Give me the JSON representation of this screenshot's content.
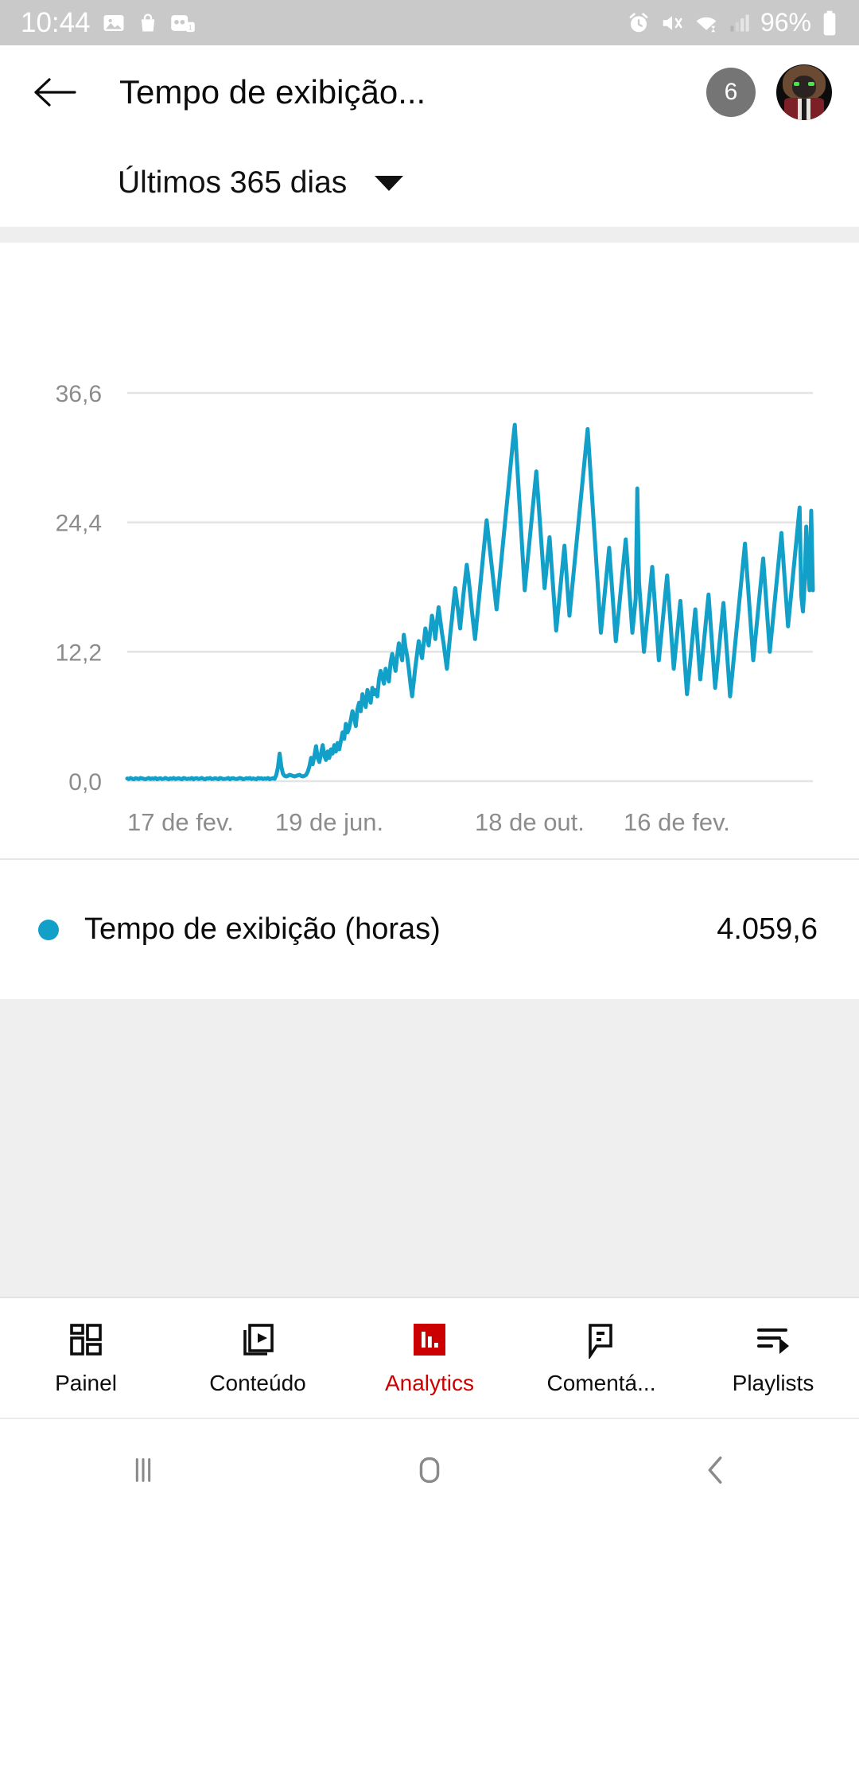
{
  "status_bar": {
    "time": "10:44",
    "battery_percent": "96%",
    "left_icons": [
      "gallery-icon",
      "shopping-bag-icon",
      "voicemail-icon"
    ],
    "right_icons": [
      "alarm-icon",
      "mute-vibrate-icon",
      "wifi-icon",
      "cellular-signal-icon"
    ]
  },
  "app_bar": {
    "back_icon": "back-arrow-icon",
    "title": "Tempo de exibição...",
    "badge_count": "6",
    "avatar_icon": "account-avatar"
  },
  "range_selector": {
    "label": "Últimos 365 dias",
    "caret_icon": "chevron-down-icon"
  },
  "legend": {
    "series_label": "Tempo de exibição (horas)",
    "total_value": "4.059,6",
    "dot_color": "#12a0c8"
  },
  "tab_bar": {
    "active_color": "#cc0000",
    "items": [
      {
        "label": "Painel",
        "icon": "dashboard-grid-icon",
        "active": false
      },
      {
        "label": "Conteúdo",
        "icon": "video-content-icon",
        "active": false
      },
      {
        "label": "Analytics",
        "icon": "bar-chart-icon",
        "active": true
      },
      {
        "label": "Comentá...",
        "icon": "comment-bubble-icon",
        "active": false
      },
      {
        "label": "Playlists",
        "icon": "playlist-icon",
        "active": false
      }
    ]
  },
  "nav_bar": {
    "items": [
      {
        "icon": "recents-icon"
      },
      {
        "icon": "home-icon"
      },
      {
        "icon": "back-icon"
      }
    ]
  },
  "chart_data": {
    "type": "line",
    "title": "Tempo de exibição (horas)",
    "xlabel": "",
    "ylabel": "",
    "grid": true,
    "legend_position": "below-chart",
    "line_color": "#12a0c8",
    "ylim": [
      0,
      36.6
    ],
    "ytick_labels": [
      "0,0",
      "12,2",
      "24,4",
      "36,6"
    ],
    "ytick_values": [
      0,
      12.2,
      24.4,
      36.6
    ],
    "xtick_labels": [
      "17 de fev.",
      "19 de jun.",
      "18 de out.",
      "16 de fev."
    ],
    "xtick_indices": [
      0,
      122,
      243,
      364
    ],
    "series": [
      {
        "name": "Tempo de exibição (horas)",
        "total": 4059.6,
        "values": [
          0.25,
          0.2,
          0.3,
          0.22,
          0.18,
          0.28,
          0.24,
          0.2,
          0.3,
          0.26,
          0.22,
          0.18,
          0.24,
          0.3,
          0.2,
          0.26,
          0.22,
          0.3,
          0.18,
          0.24,
          0.28,
          0.2,
          0.22,
          0.3,
          0.24,
          0.18,
          0.26,
          0.22,
          0.3,
          0.2,
          0.24,
          0.28,
          0.22,
          0.18,
          0.3,
          0.26,
          0.2,
          0.24,
          0.22,
          0.3,
          0.18,
          0.26,
          0.28,
          0.2,
          0.24,
          0.3,
          0.22,
          0.18,
          0.26,
          0.24,
          0.3,
          0.2,
          0.22,
          0.28,
          0.24,
          0.18,
          0.3,
          0.26,
          0.2,
          0.22,
          0.24,
          0.3,
          0.18,
          0.26,
          0.28,
          0.22,
          0.2,
          0.24,
          0.3,
          0.26,
          0.18,
          0.22,
          0.28,
          0.24,
          0.3,
          0.2,
          0.26,
          0.22,
          0.18,
          0.3,
          0.24,
          0.28,
          0.2,
          0.26,
          0.22,
          0.3,
          0.18,
          0.24,
          0.28,
          0.22,
          0.6,
          1.3,
          2.6,
          1.4,
          0.7,
          0.5,
          0.45,
          0.5,
          0.6,
          0.55,
          0.5,
          0.45,
          0.5,
          0.55,
          0.6,
          0.5,
          0.45,
          0.5,
          0.6,
          0.9,
          1.4,
          2.2,
          1.6,
          2.4,
          3.3,
          2.2,
          1.8,
          2.6,
          3.4,
          2.4,
          2.0,
          2.8,
          2.2,
          3.0,
          2.6,
          3.4,
          2.8,
          3.6,
          3.0,
          3.8,
          4.6,
          4.0,
          5.4,
          4.6,
          5.0,
          5.8,
          6.6,
          6.0,
          5.2,
          6.8,
          7.4,
          6.6,
          8.2,
          7.6,
          7.0,
          8.6,
          8.0,
          7.4,
          8.8,
          8.2,
          8.6,
          8.0,
          9.6,
          10.4,
          9.8,
          9.2,
          10.6,
          10.0,
          9.4,
          11.2,
          12.0,
          11.2,
          10.4,
          11.8,
          13.0,
          12.2,
          11.4,
          13.8,
          12.6,
          11.8,
          10.6,
          9.2,
          8.0,
          9.4,
          10.8,
          12.0,
          13.2,
          12.4,
          11.6,
          13.0,
          14.4,
          13.6,
          12.8,
          14.2,
          15.6,
          14.8,
          13.4,
          15.0,
          16.4,
          15.2,
          14.0,
          13.0,
          11.8,
          10.6,
          12.2,
          13.8,
          15.2,
          16.8,
          18.2,
          17.0,
          15.8,
          14.4,
          16.0,
          17.6,
          19.0,
          20.4,
          19.2,
          17.8,
          16.2,
          14.8,
          13.4,
          15.0,
          16.6,
          18.2,
          19.8,
          21.4,
          23.0,
          24.6,
          23.2,
          21.8,
          20.4,
          19.0,
          17.6,
          16.2,
          17.8,
          19.4,
          21.0,
          22.6,
          24.2,
          25.8,
          27.4,
          29.0,
          30.6,
          32.2,
          33.6,
          31.0,
          28.4,
          25.8,
          23.2,
          20.6,
          18.0,
          19.6,
          21.2,
          22.8,
          24.4,
          26.0,
          27.6,
          29.2,
          27.0,
          24.8,
          22.6,
          20.4,
          18.2,
          19.8,
          21.4,
          23.0,
          20.8,
          18.6,
          16.4,
          14.2,
          15.8,
          17.4,
          19.0,
          20.6,
          22.2,
          20.0,
          17.8,
          15.6,
          17.2,
          18.8,
          20.4,
          22.0,
          23.6,
          25.2,
          26.8,
          28.4,
          30.0,
          31.6,
          33.2,
          30.8,
          28.4,
          26.0,
          23.6,
          21.2,
          18.8,
          16.4,
          14.0,
          15.6,
          17.2,
          18.8,
          20.4,
          22.0,
          19.8,
          17.6,
          15.4,
          13.2,
          14.8,
          16.4,
          18.0,
          19.6,
          21.2,
          22.8,
          20.6,
          18.4,
          16.2,
          14.0,
          15.6,
          17.2,
          27.6,
          18.8,
          16.6,
          14.4,
          12.2,
          13.8,
          15.4,
          17.0,
          18.6,
          20.2,
          18.0,
          15.8,
          13.6,
          11.4,
          13.0,
          14.6,
          16.2,
          17.8,
          19.4,
          17.2,
          15.0,
          12.8,
          10.6,
          12.2,
          13.8,
          15.4,
          17.0,
          14.8,
          12.6,
          10.4,
          8.2,
          9.8,
          11.4,
          13.0,
          14.6,
          16.2,
          14.0,
          11.8,
          9.6,
          11.2,
          12.8,
          14.4,
          16.0,
          17.6,
          15.4,
          13.2,
          11.0,
          8.8,
          10.4,
          12.0,
          13.6,
          15.2,
          16.8,
          14.6,
          12.4,
          10.2,
          8.0,
          9.6,
          11.2,
          12.8,
          14.4,
          16.0,
          17.6,
          19.2,
          20.8,
          22.4,
          20.2,
          18.0,
          15.8,
          13.6,
          11.4,
          13.0,
          14.6,
          16.2,
          17.8,
          19.4,
          21.0,
          18.8,
          16.6,
          14.4,
          12.2,
          13.8,
          15.4,
          17.0,
          18.6,
          20.2,
          21.8,
          23.4,
          21.2,
          19.0,
          16.8,
          14.6,
          16.2,
          17.8,
          19.4,
          21.0,
          22.6,
          24.2,
          25.8,
          17.5,
          16.0,
          18.5,
          24.0,
          20.5,
          18.0,
          25.5,
          18.0
        ]
      }
    ]
  }
}
